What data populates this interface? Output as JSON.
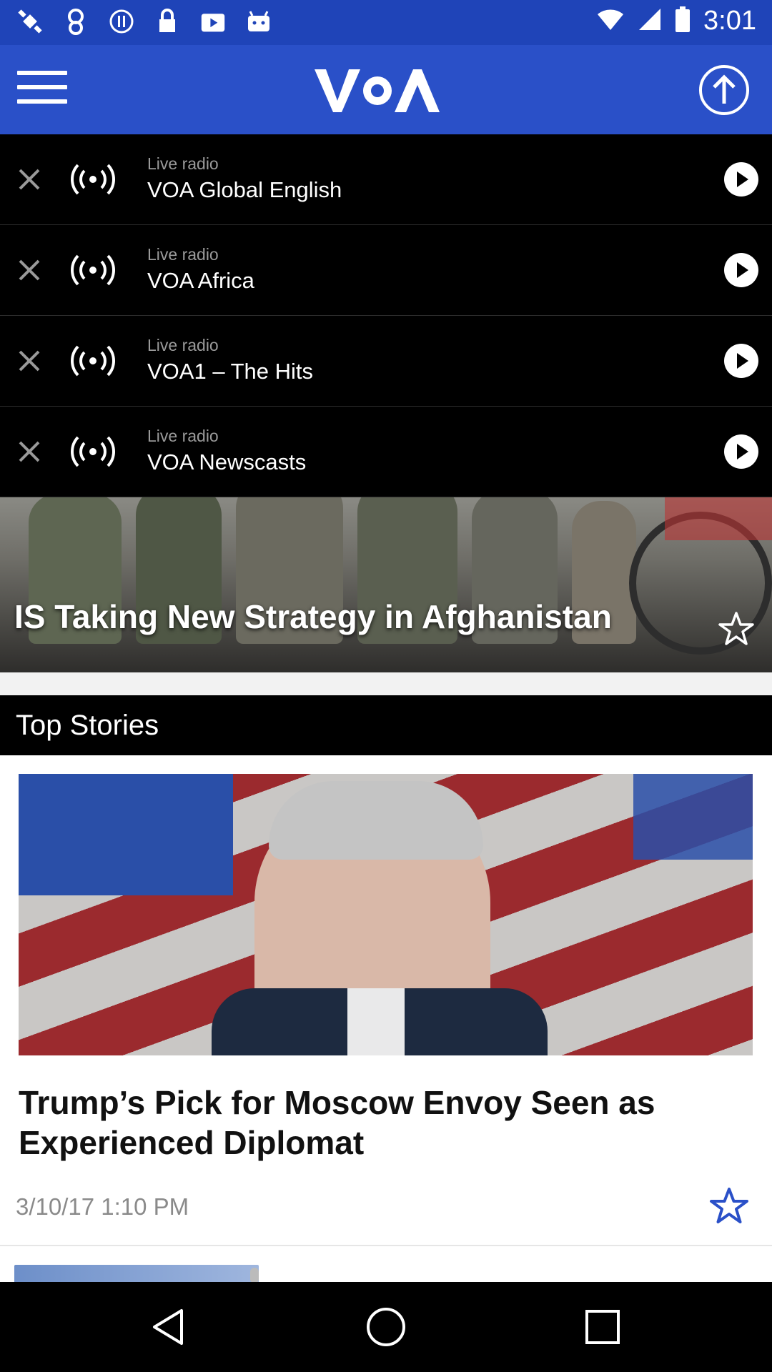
{
  "status_bar": {
    "time": "3:01",
    "icons": [
      "satellite-icon",
      "notification-icon",
      "info-icon",
      "lock-icon",
      "youtube-icon",
      "android-icon"
    ]
  },
  "app_bar": {
    "logo_text": "VOA"
  },
  "radio_stations": [
    {
      "kind": "Live radio",
      "name": "VOA Global English"
    },
    {
      "kind": "Live radio",
      "name": "VOA Africa"
    },
    {
      "kind": "Live radio",
      "name": "VOA1 – The Hits"
    },
    {
      "kind": "Live radio",
      "name": "VOA Newscasts"
    }
  ],
  "featured": {
    "title": "IS Taking New Strategy in Afghanistan"
  },
  "section": {
    "label": "Top Stories"
  },
  "story": {
    "title": "Trump’s Pick for Moscow Envoy Seen as Experienced Diplomat",
    "date": "3/10/17 1:10 PM"
  },
  "colors": {
    "brand_blue": "#2a50c8",
    "status_blue": "#1f44b8",
    "star_blue": "#2a50c8"
  }
}
